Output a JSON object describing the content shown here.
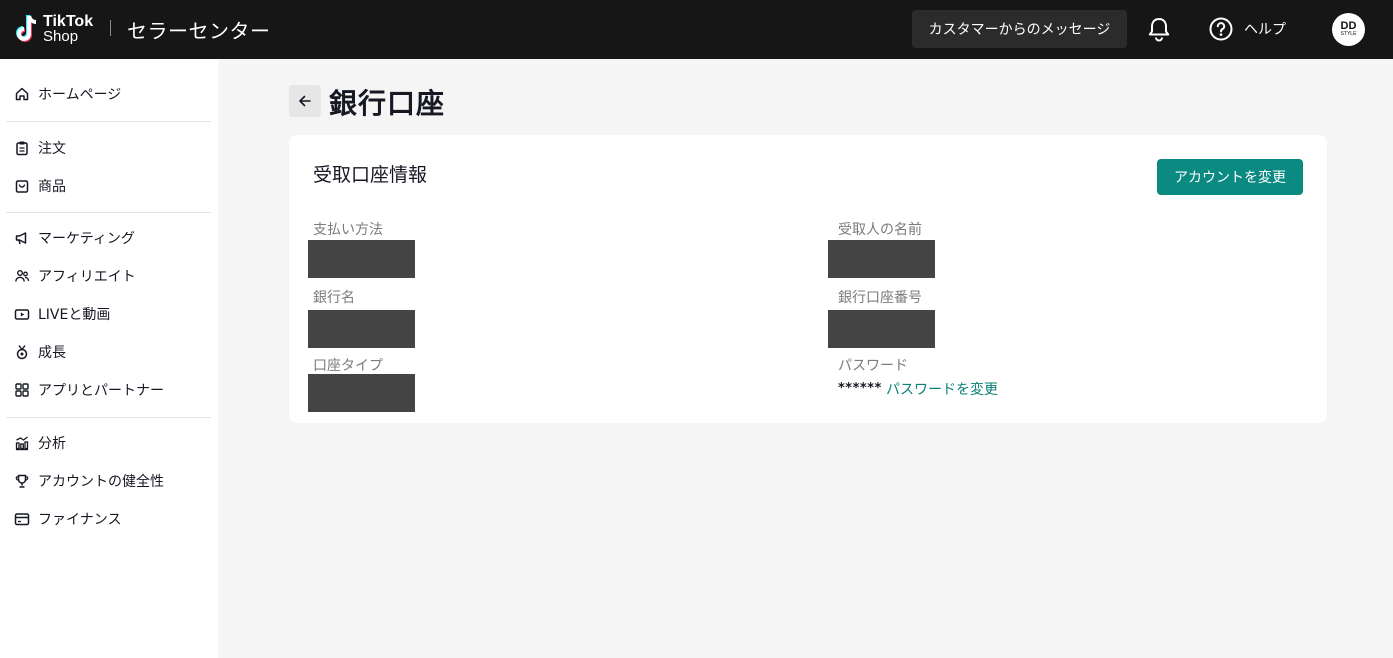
{
  "header": {
    "logo_line1": "TikTok",
    "logo_line2": "Shop",
    "title": "セラーセンター",
    "messages_label": "カスタマーからのメッセージ",
    "help_label": "ヘルプ",
    "avatar_text": "DD",
    "avatar_sub": "STYLE"
  },
  "sidebar": {
    "items": [
      {
        "label": "ホームページ",
        "icon": "home-icon"
      },
      {
        "label": "注文",
        "icon": "clipboard-icon"
      },
      {
        "label": "商品",
        "icon": "shopping-bag-icon"
      },
      {
        "label": "マーケティング",
        "icon": "megaphone-icon"
      },
      {
        "label": "アフィリエイト",
        "icon": "people-icon"
      },
      {
        "label": "LIVEと動画",
        "icon": "video-icon"
      },
      {
        "label": "成長",
        "icon": "medal-icon"
      },
      {
        "label": "アプリとパートナー",
        "icon": "apps-grid-icon"
      },
      {
        "label": "分析",
        "icon": "bar-chart-icon"
      },
      {
        "label": "アカウントの健全性",
        "icon": "trophy-icon"
      },
      {
        "label": "ファイナンス",
        "icon": "wallet-icon"
      }
    ]
  },
  "page": {
    "title": "銀行口座"
  },
  "card": {
    "title": "受取口座情報",
    "change_button": "アカウントを変更",
    "fields": {
      "payment_method": "支払い方法",
      "bank_name": "銀行名",
      "account_type": "口座タイプ",
      "recipient_name": "受取人の名前",
      "account_number": "銀行口座番号",
      "password": "パスワード"
    },
    "password_masked": "******",
    "password_change_link": "パスワードを変更"
  },
  "colors": {
    "accent": "#0b8a82",
    "topbar": "#161616",
    "redaction": "#444444"
  }
}
